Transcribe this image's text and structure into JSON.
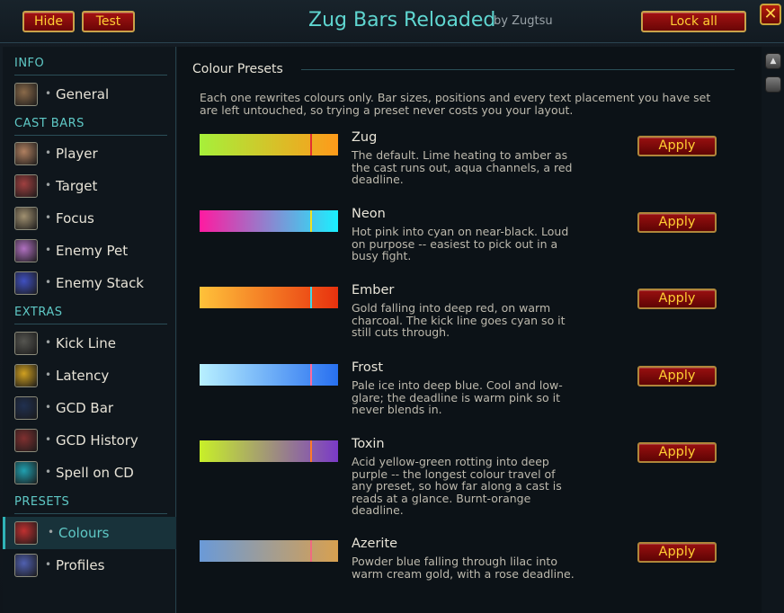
{
  "window": {
    "title": "Zug Bars Reloaded",
    "byline": "by Zugtsu",
    "hide_label": "Hide",
    "test_label": "Test",
    "lock_label": "Lock all",
    "close_glyph": "✕"
  },
  "sidebar": {
    "sections": [
      {
        "title": "INFO",
        "items": [
          {
            "label": "General",
            "icon": "general-icon",
            "color": "#8a6a4a"
          }
        ]
      },
      {
        "title": "CAST BARS",
        "items": [
          {
            "label": "Player",
            "icon": "player-icon",
            "color": "#b08060"
          },
          {
            "label": "Target",
            "icon": "target-icon",
            "color": "#a04040"
          },
          {
            "label": "Focus",
            "icon": "focus-icon",
            "color": "#a09070"
          },
          {
            "label": "Enemy Pet",
            "icon": "enemy-pet-icon",
            "color": "#b070c0"
          },
          {
            "label": "Enemy Stack",
            "icon": "enemy-stack-icon",
            "color": "#4050c0"
          }
        ]
      },
      {
        "title": "EXTRAS",
        "items": [
          {
            "label": "Kick Line",
            "icon": "kick-line-icon",
            "color": "#555550"
          },
          {
            "label": "Latency",
            "icon": "latency-icon",
            "color": "#d0a020"
          },
          {
            "label": "GCD Bar",
            "icon": "gcd-bar-icon",
            "color": "#203050"
          },
          {
            "label": "GCD History",
            "icon": "gcd-history-icon",
            "color": "#803030"
          },
          {
            "label": "Spell on CD",
            "icon": "spell-on-cd-icon",
            "color": "#20a0b0"
          }
        ]
      },
      {
        "title": "PRESETS",
        "items": [
          {
            "label": "Colours",
            "icon": "colours-icon",
            "color": "#c03030",
            "active": true
          },
          {
            "label": "Profiles",
            "icon": "profiles-icon",
            "color": "#5060b0"
          }
        ]
      }
    ]
  },
  "main": {
    "title": "Colour Presets",
    "description": "Each one rewrites colours only. Bar sizes, positions and every text placement you have set are left untouched, so trying a preset never costs you your layout.",
    "apply_label": "Apply",
    "presets": [
      {
        "name": "Zug",
        "desc": "The default. Lime heating to amber as the cast runs out, aqua channels, a red deadline.",
        "from": "#a6f03a",
        "to": "#ff9a1a",
        "deadline": "#e23030",
        "deadline_pos": 0.8
      },
      {
        "name": "Neon",
        "desc": "Hot pink into cyan on near-black. Loud on purpose -- easiest to pick out in a busy fight.",
        "from": "#ff1aa0",
        "to": "#1af0ff",
        "deadline": "#f0e020",
        "deadline_pos": 0.8
      },
      {
        "name": "Ember",
        "desc": "Gold falling into deep red, on warm charcoal. The kick line goes cyan so it still cuts through.",
        "from": "#ffc23a",
        "to": "#e8320e",
        "deadline": "#40d8e8",
        "deadline_pos": 0.8
      },
      {
        "name": "Frost",
        "desc": "Pale ice into deep blue. Cool and low-glare; the deadline is warm pink so it never blends in.",
        "from": "#b8f0ff",
        "to": "#2870f0",
        "deadline": "#ff6a9a",
        "deadline_pos": 0.8
      },
      {
        "name": "Toxin",
        "desc": "Acid yellow-green rotting into deep purple -- the longest colour travel of any preset, so how far along a cast is reads at a glance. Burnt-orange deadline.",
        "from": "#c8f028",
        "to": "#7a3ac8",
        "deadline": "#ff7a28",
        "deadline_pos": 0.8
      },
      {
        "name": "Azerite",
        "desc": "Powder blue falling through lilac into warm cream gold, with a rose deadline.",
        "from": "#6a9ad8",
        "to": "#d8a050",
        "deadline": "#f06a80",
        "deadline_pos": 0.8
      }
    ]
  }
}
